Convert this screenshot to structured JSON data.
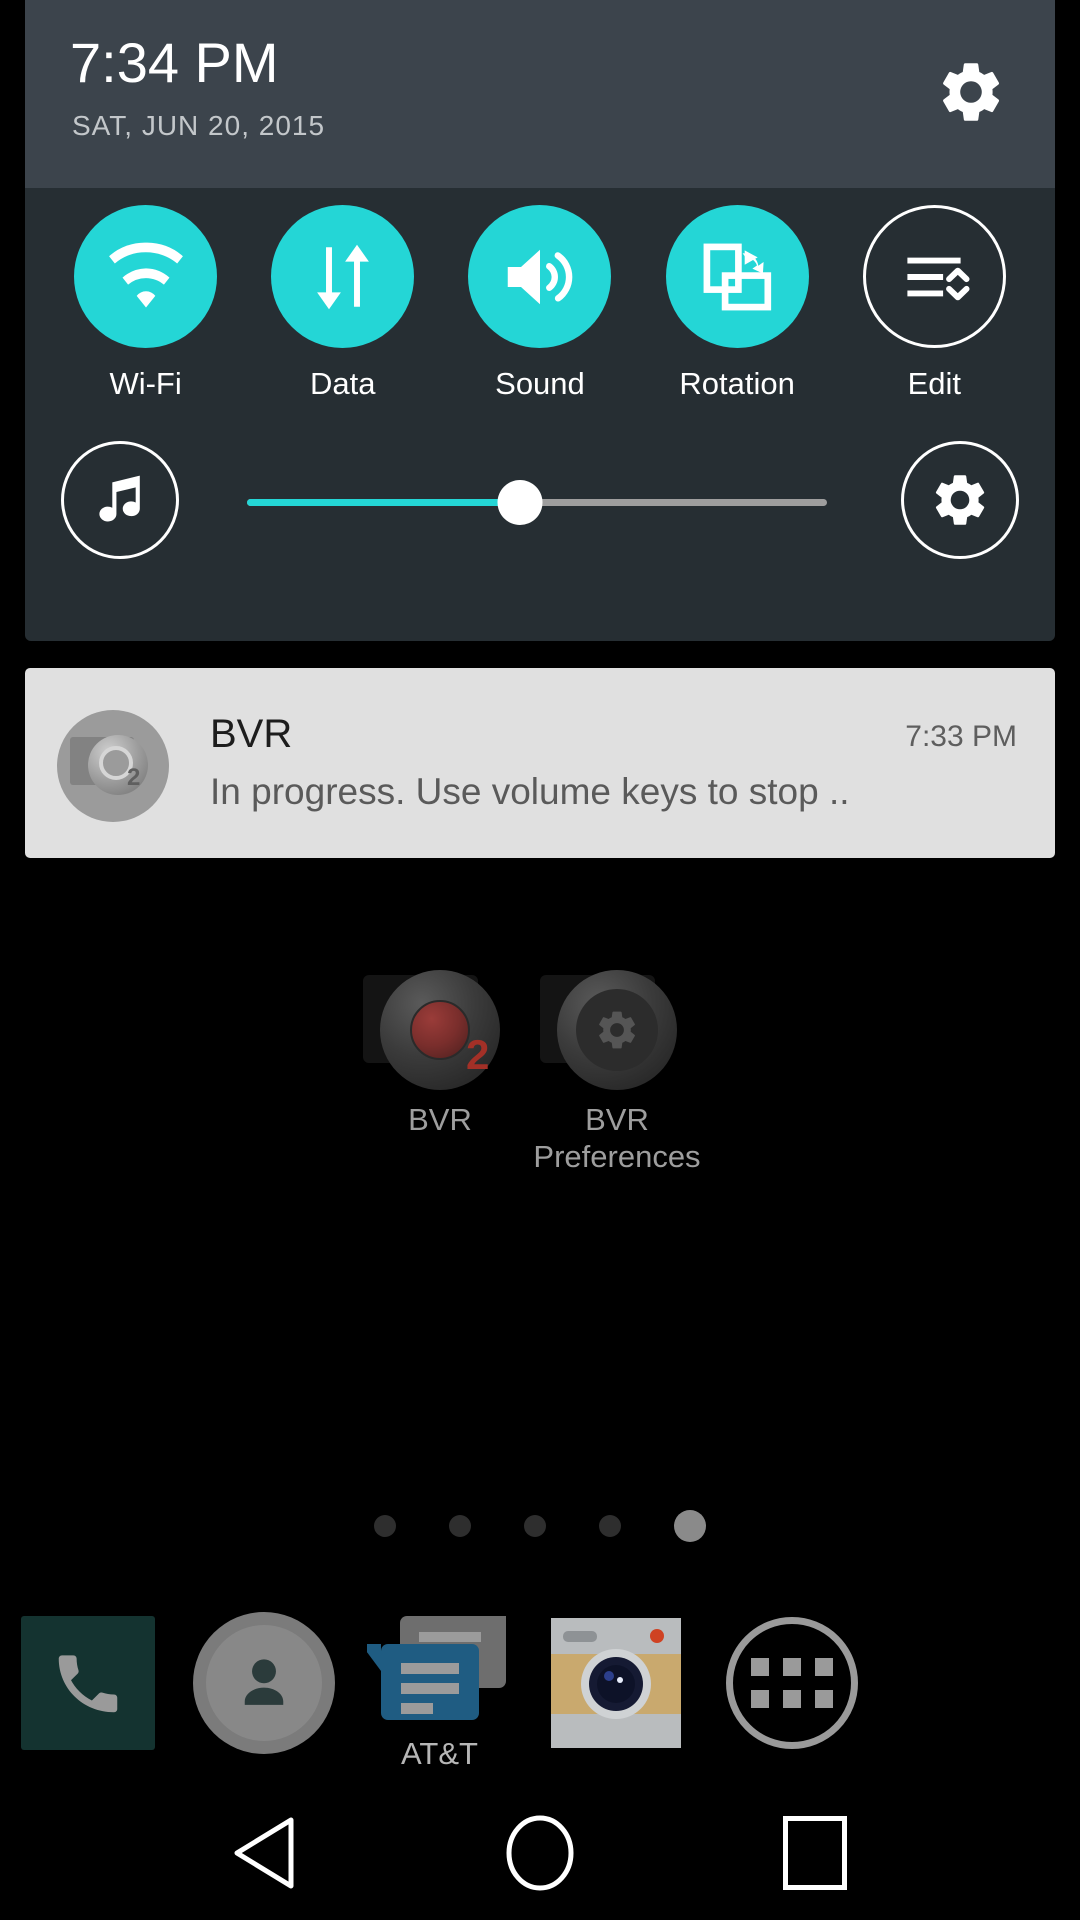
{
  "status_panel": {
    "clock": "7:34 PM",
    "date": "SAT, JUN 20, 2015",
    "settings_icon": "gear-icon",
    "accent_color": "#24d6d6",
    "header_bg": "#3c444c",
    "panel_bg": "#262e33",
    "toggles": [
      {
        "label": "Wi-Fi",
        "icon": "wifi-icon",
        "state": "on"
      },
      {
        "label": "Data",
        "icon": "data-sync-icon",
        "state": "on"
      },
      {
        "label": "Sound",
        "icon": "speaker-icon",
        "state": "on"
      },
      {
        "label": "Rotation",
        "icon": "rotation-icon",
        "state": "on"
      },
      {
        "label": "Edit",
        "icon": "edit-list-icon",
        "state": "outline"
      }
    ],
    "slider": {
      "left_icon": "music-note-icon",
      "right_icon": "gear-icon",
      "value_percent": 47,
      "fill_color": "#24d6d6",
      "track_color": "#9e9e9e"
    }
  },
  "notification": {
    "app_name": "BVR",
    "time": "7:33 PM",
    "text": "In progress. Use volume keys to stop ..",
    "avatar_icon": "bvr-recorder-icon",
    "background": "#e0e0e0"
  },
  "home_screen": {
    "apps": [
      {
        "label": "BVR",
        "icon": "bvr-recorder-icon",
        "badge": "2"
      },
      {
        "label": "BVR\nPreferences",
        "label_line1": "BVR",
        "label_line2": "Preferences",
        "icon": "bvr-preferences-icon"
      }
    ],
    "page_indicator": {
      "total": 5,
      "active_index": 4
    }
  },
  "dock": {
    "items": [
      {
        "label": "",
        "icon": "phone-icon"
      },
      {
        "label": "",
        "icon": "contacts-person-icon"
      },
      {
        "label": "AT&T",
        "icon": "messaging-icon"
      },
      {
        "label": "",
        "icon": "camera-icon"
      },
      {
        "label": "",
        "icon": "app-drawer-icon"
      }
    ]
  },
  "navbar": {
    "buttons": [
      {
        "name": "back",
        "icon": "back-triangle-icon"
      },
      {
        "name": "home",
        "icon": "home-circle-icon"
      },
      {
        "name": "recents",
        "icon": "recents-square-icon"
      }
    ]
  }
}
